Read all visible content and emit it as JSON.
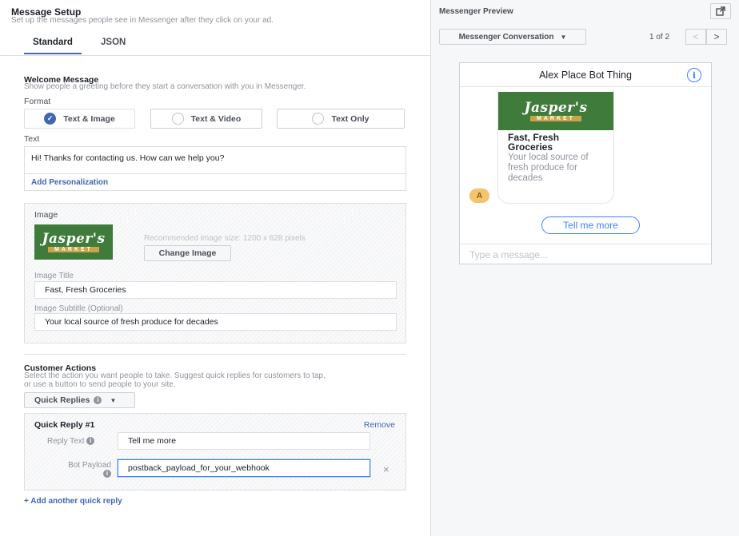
{
  "setup": {
    "title": "Message Setup",
    "subtitle": "Set up the messages people see in Messenger after they click on your ad.",
    "tabs": [
      {
        "label": "Standard"
      },
      {
        "label": "JSON"
      }
    ]
  },
  "welcome": {
    "title": "Welcome Message",
    "subtitle": "Show people a greeting before they start a conversation with you in Messenger.",
    "format_label": "Format",
    "formats": [
      {
        "label": "Text & Image",
        "selected": true
      },
      {
        "label": "Text & Video",
        "selected": false
      },
      {
        "label": "Text Only",
        "selected": false
      }
    ],
    "text_label": "Text",
    "text_value": "Hi! Thanks for contacting us. How can we help you?",
    "add_personalization": "Add Personalization"
  },
  "image": {
    "label": "Image",
    "logo_text": "Jasper's",
    "logo_subtext": "MARKET",
    "recommended": "Recommended image size: 1200 x 628 pixels",
    "change_button": "Change Image",
    "title_label": "Image Title",
    "title_value": "Fast, Fresh Groceries",
    "subtitle_label": "Image Subtitle (Optional)",
    "subtitle_value": "Your local source of fresh produce for decades"
  },
  "customer_actions": {
    "title": "Customer Actions",
    "subtitle_line1": "Select the action you want people to take. Suggest quick replies for customers to tap,",
    "subtitle_line2": "or use a button to send people to your site.",
    "dropdown_label": "Quick Replies",
    "quick_reply": {
      "header": "Quick Reply #1",
      "remove": "Remove",
      "reply_text_label": "Reply Text",
      "reply_text_value": "Tell me more",
      "payload_label": "Bot Payload",
      "payload_value": "postback_payload_for_your_webhook",
      "clear": "×"
    },
    "add_another": "+ Add another quick reply"
  },
  "preview": {
    "title": "Messenger Preview",
    "conversation_dropdown": "Messenger Conversation",
    "pager": "1 of 2",
    "prev": "<",
    "next": ">",
    "bot_name": "Alex Place Bot Thing",
    "info_glyph": "i",
    "card_title": "Fast, Fresh Groceries",
    "card_subtitle": "Your local source of fresh produce for decades",
    "avatar_letter": "A",
    "quick_reply_pill": "Tell me more",
    "composer_placeholder": "Type a message..."
  },
  "colors": {
    "accent": "#4267b2",
    "messenger_blue": "#4080ff",
    "thumb_green": "#3f7b3a"
  },
  "icons": {
    "checked_radio": "check-icon",
    "open_external": "external-link-icon",
    "dropdown": "caret-down-icon",
    "info": "info-icon"
  }
}
